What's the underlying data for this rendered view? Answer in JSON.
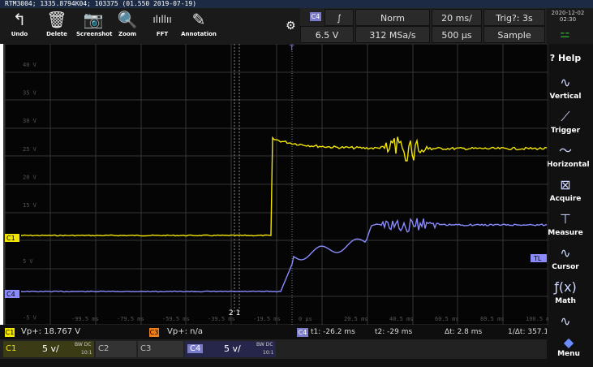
{
  "title_bar": "RTM3004; 1335.8794K04; 103375 (01.550 2019-07-19)",
  "toolbar": {
    "undo": "Undo",
    "delete": "Delete",
    "screenshot": "Screenshot",
    "zoom": "Zoom",
    "fft": "FFT",
    "annotation": "Annotation"
  },
  "acq": {
    "channel_tag": "C4",
    "trigger_slope": "∫",
    "mode": "Norm",
    "timebase": "20 ms/",
    "trig_status": "Trig?: 3s",
    "level": "6.5 V",
    "sample_rate": "312 MSa/s",
    "position": "500 µs",
    "acq_mode": "Sample"
  },
  "datetime": {
    "date": "2020-12-02",
    "time": "02:30"
  },
  "side_menu": {
    "help": "Help",
    "vertical": "Vertical",
    "trigger": "Trigger",
    "horizontal": "Horizontal",
    "acquire": "Acquire",
    "measure": "Measure",
    "cursor": "Cursor",
    "math": "Math",
    "menu": "Menu"
  },
  "screen": {
    "y_labels": [
      "40 V",
      "35 V",
      "30 V",
      "25 V",
      "20 V",
      "15 V",
      "",
      "5 V",
      "",
      "-5 V"
    ],
    "x_labels": [
      "-99.5 ms",
      "-79.5 ms",
      "-59.5 ms",
      "-39.5 ms",
      "-19.5 ms",
      "0 µs",
      "20.5 ms",
      "40.5 ms",
      "60.5 ms",
      "80.5 ms",
      "100.5 ms"
    ],
    "marker_c1": "C1",
    "marker_c4": "C4",
    "marker_tl": "TL",
    "cursor_label": "2 1",
    "trigger_marker": "T"
  },
  "measure": {
    "c1_tag": "C1",
    "c1_text": "Vp+: 18.767 V",
    "c3_tag": "C3",
    "c3_text": "Vp+: n/a",
    "cursor_tag": "C4",
    "t1": "t1: -26.2 ms",
    "t2": "t2: -29 ms",
    "dt": "Δt: 2.8 ms",
    "inv_dt": "1/Δt: 357.1..."
  },
  "channels": {
    "c1_label": "C1",
    "c1_scale": "5 v/",
    "c1_cpl": "BW DC",
    "c1_probe": "10:1",
    "c2_label": "C2",
    "c3_label": "C3",
    "c4_label": "C4",
    "c4_scale": "5 v/",
    "c4_cpl": "BW DC",
    "c4_probe": "10:1"
  },
  "colors": {
    "c1": "#f2e600",
    "c4": "#8a8aff",
    "c3": "#f07f1a",
    "grid": "#3a3a3a",
    "bg": "#050505"
  }
}
